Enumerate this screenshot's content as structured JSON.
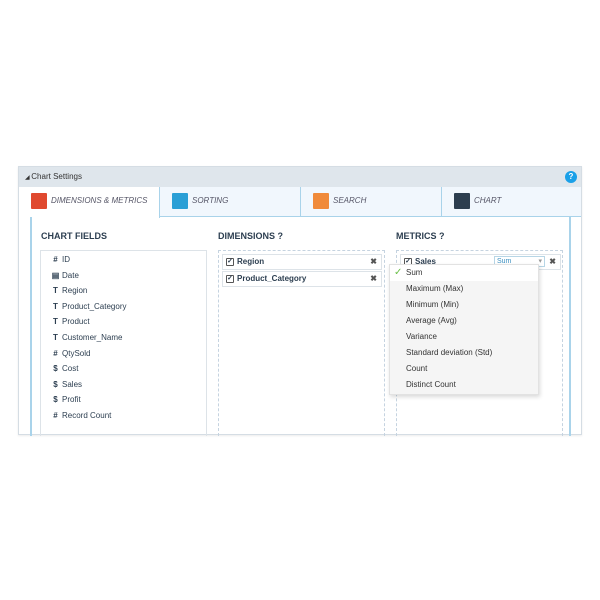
{
  "panel": {
    "title": "Chart Settings",
    "help": "?"
  },
  "tabs": [
    {
      "label": "DIMENSIONS & METRICS",
      "icon": "dimensions-icon",
      "color": "#e0492f",
      "active": true
    },
    {
      "label": "SORTING",
      "icon": "sort-icon",
      "color": "#2a9fd6"
    },
    {
      "label": "SEARCH",
      "icon": "search-icon",
      "color": "#f08a3a"
    },
    {
      "label": "CHART",
      "icon": "bar-chart-icon",
      "color": "#2d3e4f"
    }
  ],
  "chart_fields": {
    "title": "CHART FIELDS",
    "items": [
      {
        "icon": "#",
        "label": "ID"
      },
      {
        "icon": "▤",
        "label": "Date"
      },
      {
        "icon": "T",
        "label": "Region"
      },
      {
        "icon": "T",
        "label": "Product_Category"
      },
      {
        "icon": "T",
        "label": "Product"
      },
      {
        "icon": "T",
        "label": "Customer_Name"
      },
      {
        "icon": "#",
        "label": "QtySold"
      },
      {
        "icon": "$",
        "label": "Cost"
      },
      {
        "icon": "$",
        "label": "Sales"
      },
      {
        "icon": "$",
        "label": "Profit"
      },
      {
        "icon": "#",
        "label": "Record Count"
      }
    ]
  },
  "dimensions": {
    "title": "DIMENSIONS",
    "help": "?",
    "items": [
      {
        "label": "Region",
        "checked": true
      },
      {
        "label": "Product_Category",
        "checked": true
      }
    ]
  },
  "metrics": {
    "title": "METRICS",
    "help": "?",
    "items": [
      {
        "label": "Sales",
        "checked": true,
        "aggregation": "Sum"
      }
    ]
  },
  "dropdown": {
    "selected": "Sum",
    "options": [
      "Sum",
      "Maximum (Max)",
      "Minimum (Min)",
      "Average (Avg)",
      "Variance",
      "Standard deviation (Std)",
      "Count",
      "Distinct Count"
    ]
  }
}
